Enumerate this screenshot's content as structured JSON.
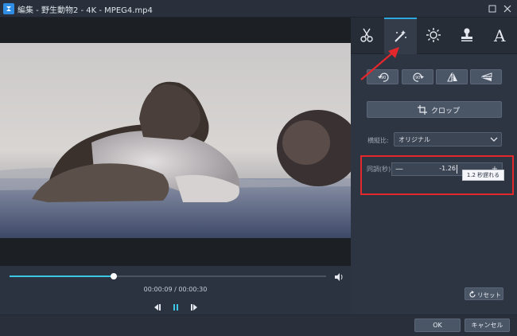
{
  "window": {
    "title": "編集 - 野生動物2 - 4K - MPEG4.mp4"
  },
  "tabs": [
    {
      "name": "trim",
      "icon": "scissors-icon",
      "active": false
    },
    {
      "name": "effects",
      "icon": "magic-wand-icon",
      "active": true
    },
    {
      "name": "adjust",
      "icon": "brightness-icon",
      "active": false
    },
    {
      "name": "watermark",
      "icon": "stamp-icon",
      "active": false
    },
    {
      "name": "text",
      "icon": "text-icon",
      "active": false
    }
  ],
  "rotate_buttons": [
    {
      "icon": "rotate-left-90-icon",
      "label": "90"
    },
    {
      "icon": "rotate-right-90-icon",
      "label": "90"
    },
    {
      "icon": "flip-horizontal-icon",
      "label": ""
    },
    {
      "icon": "flip-vertical-icon",
      "label": ""
    }
  ],
  "crop": {
    "label": "クロップ"
  },
  "aspect": {
    "label": "横縦比:",
    "value": "オリジナル"
  },
  "sync": {
    "label": "同調(秒):",
    "value": "-1.26",
    "minus": "—",
    "plus": "+",
    "tooltip": "1.2 秒遅れる"
  },
  "player": {
    "timecode": "00:00:09 / 00:00:30",
    "progress": 0.33
  },
  "reset": {
    "label": "リセット"
  },
  "footer": {
    "ok": "OK",
    "cancel": "キャンセル"
  },
  "colors": {
    "accent": "#2ea9e0",
    "highlight": "#e3272b",
    "progress": "#3ec6e6"
  }
}
